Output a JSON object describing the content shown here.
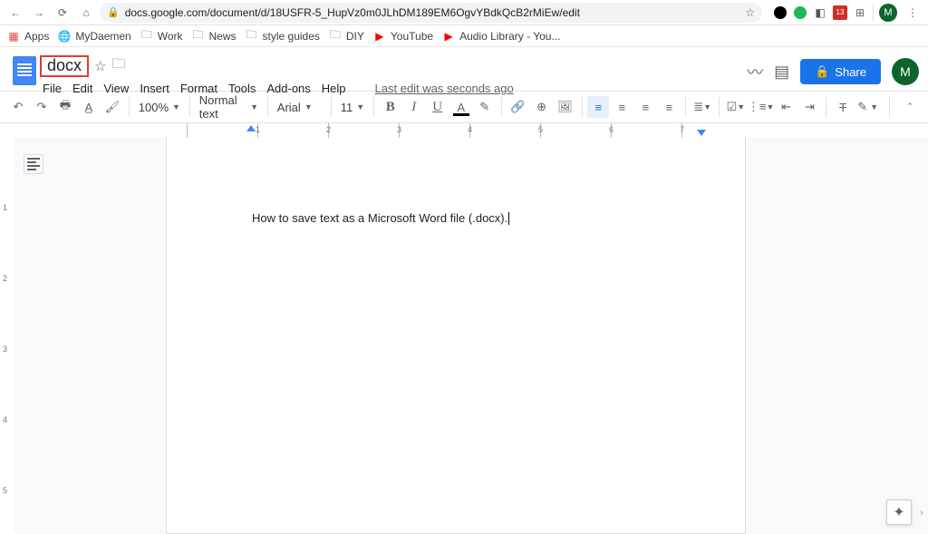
{
  "browser": {
    "url": "docs.google.com/document/d/18USFR-5_HupVz0m0JLhDM189EM6OgvYBdkQcB2rMiEw/edit",
    "avatar_letter": "M",
    "ext_badge": "13",
    "bookmarks": {
      "apps": "Apps",
      "items": [
        "MyDaemen",
        "Work",
        "News",
        "style guides",
        "DIY",
        "YouTube",
        "Audio Library - You..."
      ]
    }
  },
  "gdocs": {
    "title": "docx",
    "menus": [
      "File",
      "Edit",
      "View",
      "Insert",
      "Format",
      "Tools",
      "Add-ons",
      "Help"
    ],
    "last_edit": "Last edit was seconds ago",
    "share_label": "Share",
    "avatar_letter": "M"
  },
  "toolbar": {
    "zoom": "100%",
    "style": "Normal text",
    "font": "Arial",
    "size": "11"
  },
  "ruler": {
    "inches": [
      "1",
      "2",
      "3",
      "4",
      "5",
      "6",
      "7"
    ]
  },
  "document": {
    "body_text": "How to save text as a Microsoft Word file (.docx)."
  }
}
